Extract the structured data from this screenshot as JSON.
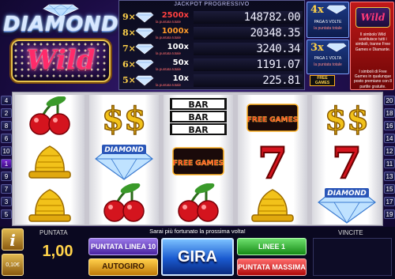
{
  "logo": {
    "line1": "DIAMOND",
    "line2": "Wild"
  },
  "paytable": {
    "title": "JACKPOT PROGRESSIVO",
    "note": "la puntata totale",
    "rows": [
      {
        "count": "9×",
        "mult": "2500x",
        "amount": "148782.00",
        "color": "#ff4040"
      },
      {
        "count": "8×",
        "mult": "1000x",
        "amount": "20348.35",
        "color": "#ff9a2a"
      },
      {
        "count": "7×",
        "mult": "100x",
        "amount": "3240.34",
        "color": "#ffffff"
      },
      {
        "count": "6×",
        "mult": "50x",
        "amount": "1191.07",
        "color": "#ffffff"
      },
      {
        "count": "5×",
        "mult": "10x",
        "amount": "225.81",
        "color": "#ffffff"
      }
    ]
  },
  "info": {
    "box1_big": "4x",
    "box1_text": "PAGA 5 VOLTE",
    "box1_sub": "la puntata totale",
    "box2_big": "3x",
    "box2_text": "PAGA 1 VOLTA",
    "box2_sub": "la puntata totale",
    "free_games_badge": "FREE GAMES",
    "wild_text": "Il simbolo Wild sostituisce tutti i simboli, tranne Free Games e Diamante.",
    "free_text": "I simboli di Free Games in qualunque posto premiano con 8 partite gratuite.",
    "wild_mini": "Wild"
  },
  "lines": {
    "left": [
      "4",
      "2",
      "8",
      "6",
      "10",
      "1",
      "9",
      "7",
      "3",
      "5"
    ],
    "right": [
      "20",
      "18",
      "16",
      "14",
      "12",
      "11",
      "13",
      "15",
      "17",
      "19"
    ]
  },
  "reels": [
    [
      "cherries",
      "bell",
      "bell"
    ],
    [
      "dollar",
      "diamond",
      "cherries"
    ],
    [
      "bar3",
      "free-games",
      "cherries"
    ],
    [
      "free-games",
      "seven",
      "bell"
    ],
    [
      "dollar",
      "seven",
      "diamond"
    ]
  ],
  "symbols": {
    "bar_label": "BAR",
    "free_games_label": "FREE GAMES",
    "diamond_label": "DIAMOND",
    "dollar_glyph": "$$",
    "seven_glyph": "7"
  },
  "bottom": {
    "message": "Sarai più fortunato la prossima volta!",
    "info_glyph": "i",
    "coin_value": "0,10€",
    "bet_label": "PUNTATA",
    "bet_value": "1,00",
    "btn_bet_line": "PUNTATA LINEA 10",
    "btn_autospin": "AUTOGIRO",
    "btn_spin": "GIRA",
    "btn_lines": "LINEE 1",
    "btn_max": "PUNTATA MASSIMA",
    "win_label": "VINCITE"
  }
}
